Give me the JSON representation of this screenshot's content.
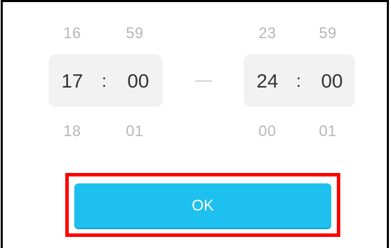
{
  "picker": {
    "start": {
      "hour_above": "16",
      "minute_above": "59",
      "hour": "17",
      "minute": "00",
      "hour_below": "18",
      "minute_below": "01"
    },
    "separator": ":",
    "range_dash": "—",
    "end": {
      "hour_above": "23",
      "minute_above": "59",
      "hour": "24",
      "minute": "00",
      "hour_below": "00",
      "minute_below": "01"
    }
  },
  "ok_button": {
    "label": "OK"
  },
  "colors": {
    "accent": "#1ec0ef",
    "highlight_border": "#ff0000"
  }
}
